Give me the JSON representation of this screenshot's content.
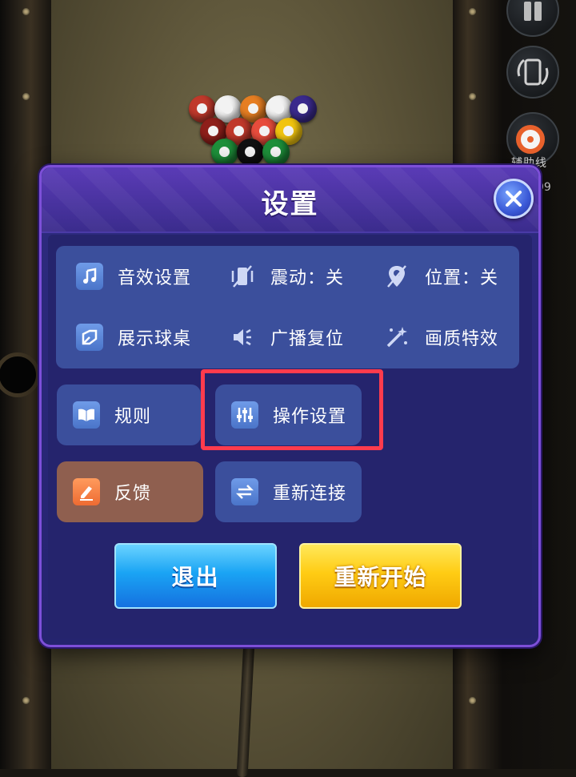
{
  "dialog": {
    "title": "设置",
    "close_icon": "close-icon"
  },
  "settings_panel": {
    "items": [
      {
        "label": "音效设置",
        "icon": "music-note-icon"
      },
      {
        "label": "震动：关",
        "icon": "vibration-off-icon"
      },
      {
        "label": "位置：关",
        "icon": "location-off-icon"
      },
      {
        "label": "展示球桌",
        "icon": "table-display-icon"
      },
      {
        "label": "广播复位",
        "icon": "speaker-icon"
      },
      {
        "label": "画质特效",
        "icon": "magic-wand-icon"
      }
    ]
  },
  "tiles": {
    "rules": {
      "label": "规则",
      "icon": "book-icon"
    },
    "controls": {
      "label": "操作设置",
      "icon": "sliders-icon"
    },
    "feedback": {
      "label": "反馈",
      "icon": "pencil-icon"
    },
    "reconnect": {
      "label": "重新连接",
      "icon": "swap-arrows-icon"
    }
  },
  "buttons": {
    "exit": "退出",
    "restart": "重新开始"
  },
  "side_panel": {
    "aim_label": "辅助线",
    "counter": "99"
  },
  "colors": {
    "dialog_bg": "#25246f",
    "dialog_border": "#7d4fd8",
    "tile_bg": "#3b4f9c",
    "feedback_tile_bg": "#8f5f4f",
    "highlight": "#ff3b4d",
    "exit_button": "#1aa4f4",
    "restart_button": "#ffcc14"
  }
}
